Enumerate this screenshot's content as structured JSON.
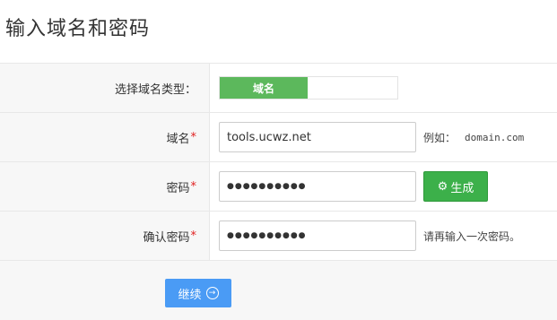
{
  "page": {
    "title": "输入域名和密码"
  },
  "form": {
    "type_row": {
      "label": "选择域名类型：",
      "active_option": "域名"
    },
    "domain_row": {
      "label": "域名",
      "required_mark": "*",
      "value": "tools.ucwz.net",
      "hint_prefix": "例如：",
      "hint_example": "domain.com"
    },
    "password_row": {
      "label": "密码",
      "required_mark": "*",
      "value": "●●●●●●●●●●",
      "generate_icon": "gear-icon",
      "generate_label": "生成"
    },
    "confirm_row": {
      "label": "确认密码",
      "required_mark": "*",
      "value": "●●●●●●●●●●",
      "hint": "请再输入一次密码。"
    }
  },
  "footer": {
    "continue_label": "继续",
    "continue_icon": "arrow-right-circle-icon"
  },
  "colors": {
    "accent_green": "#5cb85c",
    "button_green": "#3cb04a",
    "button_blue": "#4a9bf5",
    "required_red": "#e02020"
  }
}
